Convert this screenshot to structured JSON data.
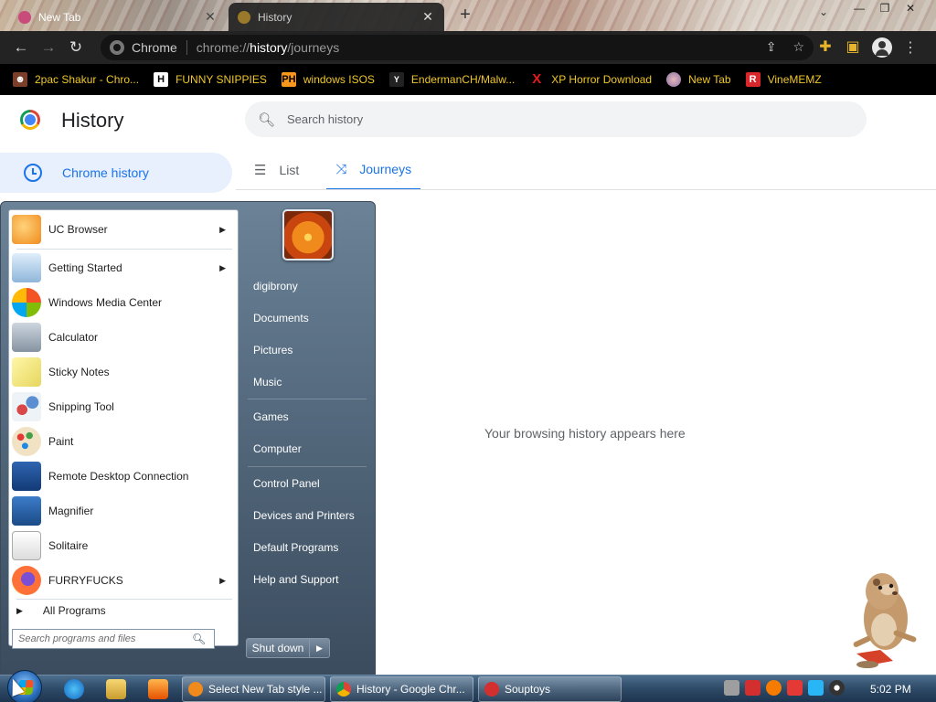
{
  "colors": {
    "chrome_accent": "#1a73e8",
    "bookmark_text": "#f0c72a",
    "toolbar_bg": "#232323",
    "startmenu_bg": "#54697d",
    "taskbar_bg": "#2d4a66"
  },
  "tabs": [
    {
      "title": "New Tab",
      "state": "inactive"
    },
    {
      "title": "History",
      "state": "active"
    }
  ],
  "omnibox": {
    "site_label": "Chrome",
    "url_prefix": "chrome://",
    "url_host": "history",
    "url_path": "/journeys"
  },
  "bookmarks": [
    {
      "label": "2pac Shakur - Chro...",
      "icon": "2pac-icon"
    },
    {
      "label": "FUNNY SNIPPIES",
      "icon": "h-icon"
    },
    {
      "label": "windows ISOS",
      "icon": "ph-icon"
    },
    {
      "label": "EndermanCH/Malw...",
      "icon": "yp-icon"
    },
    {
      "label": "XP Horror Download",
      "icon": "x-icon"
    },
    {
      "label": "New Tab",
      "icon": "globe-icon"
    },
    {
      "label": "VineMEMZ",
      "icon": "r-icon"
    }
  ],
  "history": {
    "title": "History",
    "search_placeholder": "Search history",
    "nav_item": "Chrome history",
    "tab_list": "List",
    "tab_journeys": "Journeys",
    "empty_message": "Your browsing history appears here"
  },
  "start_menu": {
    "programs": [
      {
        "label": "UC Browser",
        "has_submenu": true,
        "icon": "uc-browser-icon"
      },
      {
        "label": "Getting Started",
        "has_submenu": true,
        "icon": "getting-started-icon"
      },
      {
        "label": "Windows Media Center",
        "has_submenu": false,
        "icon": "media-center-icon"
      },
      {
        "label": "Calculator",
        "has_submenu": false,
        "icon": "calculator-icon"
      },
      {
        "label": "Sticky Notes",
        "has_submenu": false,
        "icon": "sticky-notes-icon"
      },
      {
        "label": "Snipping Tool",
        "has_submenu": false,
        "icon": "snipping-tool-icon"
      },
      {
        "label": "Paint",
        "has_submenu": false,
        "icon": "paint-icon"
      },
      {
        "label": "Remote Desktop Connection",
        "has_submenu": false,
        "icon": "remote-desktop-icon"
      },
      {
        "label": "Magnifier",
        "has_submenu": false,
        "icon": "magnifier-icon"
      },
      {
        "label": "Solitaire",
        "has_submenu": false,
        "icon": "solitaire-icon"
      },
      {
        "label": "FURRYFUCKS",
        "has_submenu": true,
        "icon": "firefox-icon"
      }
    ],
    "all_programs": "All Programs",
    "search_placeholder": "Search programs and files",
    "right_items": [
      "digibrony",
      "Documents",
      "Pictures",
      "Music",
      "Games",
      "Computer",
      "Control Panel",
      "Devices and Printers",
      "Default Programs",
      "Help and Support"
    ],
    "shutdown_label": "Shut down"
  },
  "taskbar": {
    "tasks": [
      {
        "label": "Select New Tab style ...",
        "icon": "uc-browser-icon"
      },
      {
        "label": "History - Google Chr...",
        "icon": "chrome-icon"
      },
      {
        "label": "Souptoys",
        "icon": "souptoys-icon"
      }
    ],
    "clock": "5:02 PM"
  }
}
